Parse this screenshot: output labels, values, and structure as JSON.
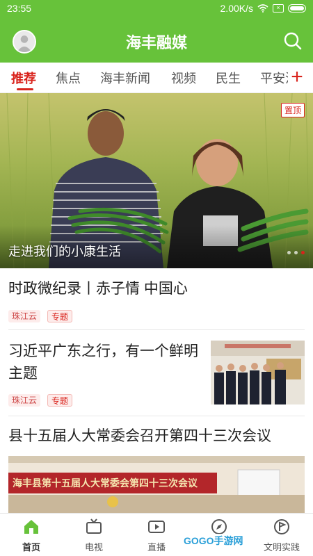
{
  "status_bar": {
    "time": "23:55",
    "speed": "2.00K/s"
  },
  "header": {
    "title": "海丰融媒"
  },
  "tabs": [
    {
      "label": "推荐",
      "active": true
    },
    {
      "label": "焦点"
    },
    {
      "label": "海丰新闻"
    },
    {
      "label": "视频"
    },
    {
      "label": "民生"
    },
    {
      "label": "平安汕"
    }
  ],
  "add_tab_label": "+",
  "banner": {
    "badge": "置顶",
    "caption": "走进我们的小康生活",
    "slides": 3,
    "active_slide": 3
  },
  "feed": [
    {
      "title": "时政微纪录丨赤子情 中国心",
      "source": "珠江云",
      "tag": "专题"
    },
    {
      "title_line1": "习近平广东之行，有一个鲜明",
      "title_line2": "主题",
      "source": "珠江云",
      "tag": "专题"
    },
    {
      "title": "县十五届人大常委会召开第四十三次会议",
      "banner_text": "海丰县第十五届人大常委会第四十三次会议"
    }
  ],
  "bottom_nav": [
    {
      "label": "首页",
      "icon": "home-icon",
      "active": true
    },
    {
      "label": "电视",
      "icon": "tv-icon"
    },
    {
      "label": "直播",
      "icon": "live-icon"
    },
    {
      "label": "",
      "icon": "compass-icon"
    },
    {
      "label": "文明实践",
      "icon": "flag-icon"
    }
  ],
  "watermark": "GOGO手游网",
  "colors": {
    "brand_green": "#67c23a",
    "accent_red": "#d9231c"
  }
}
